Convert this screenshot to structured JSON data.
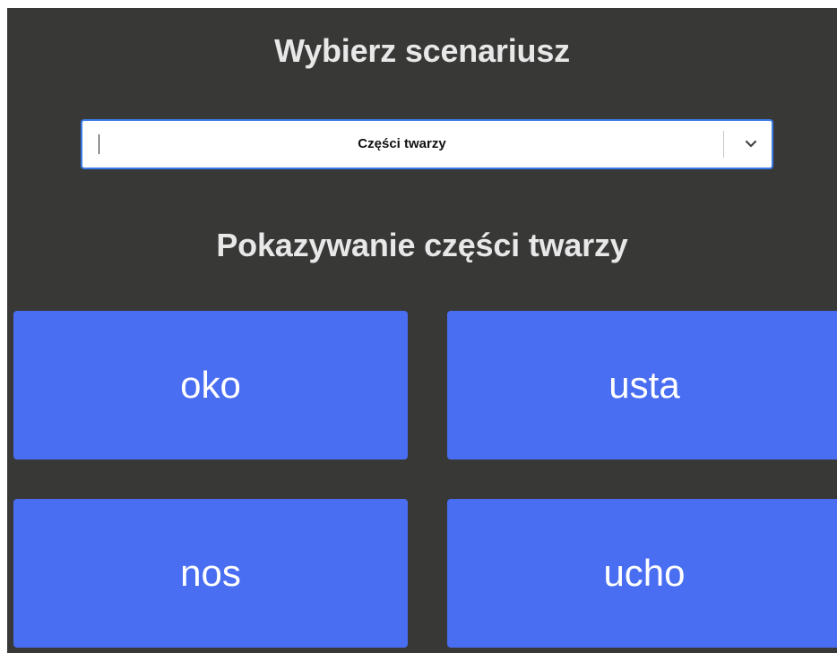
{
  "header": {
    "title": "Wybierz scenariusz"
  },
  "scenario_select": {
    "selected": "Części twarzy",
    "arrow_icon": "chevron-down-icon"
  },
  "scenario": {
    "title": "Pokazywanie części twarzy",
    "tile_color": "#4a6ef2",
    "background_color": "#383837",
    "options": [
      {
        "label": "oko"
      },
      {
        "label": "usta"
      },
      {
        "label": "nos"
      },
      {
        "label": "ucho"
      }
    ]
  }
}
